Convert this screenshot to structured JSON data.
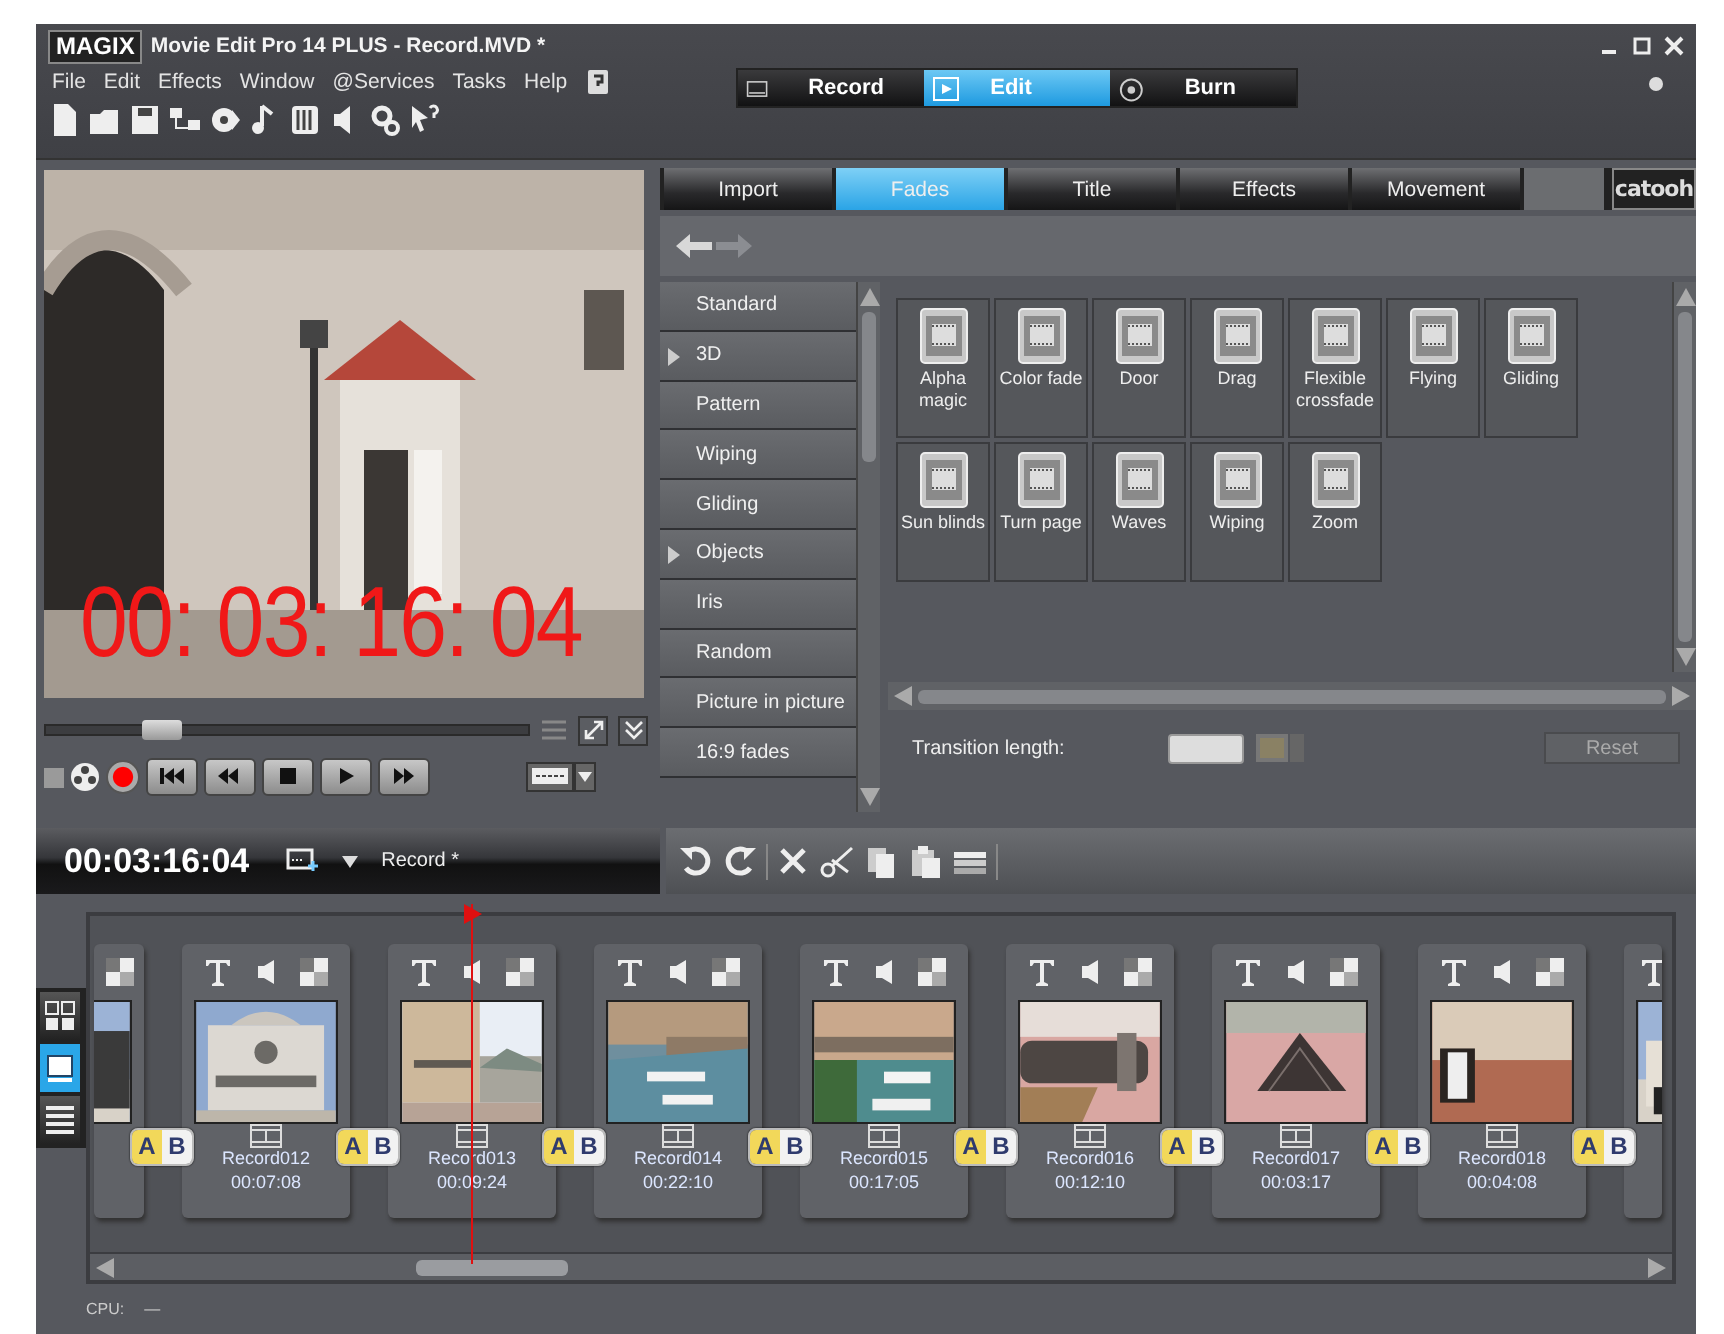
{
  "window": {
    "logo": "MAGIX",
    "title": "Movie Edit Pro 14 PLUS - Record.MVD *"
  },
  "menu": [
    "File",
    "Edit",
    "Effects",
    "Window",
    "@Services",
    "Tasks",
    "Help"
  ],
  "modes": [
    {
      "label": "Record",
      "selected": false
    },
    {
      "label": "Edit",
      "selected": true
    },
    {
      "label": "Burn",
      "selected": false
    }
  ],
  "preview": {
    "timecode_overlay": "00: 03: 16: 04",
    "level": 0.2
  },
  "panel": {
    "tabs": [
      {
        "label": "Import",
        "selected": false
      },
      {
        "label": "Fades",
        "selected": true
      },
      {
        "label": "Title",
        "selected": false
      },
      {
        "label": "Effects",
        "selected": false
      },
      {
        "label": "Movement",
        "selected": false
      }
    ],
    "logo": "catooh",
    "categories": [
      {
        "label": "Standard",
        "expandable": false
      },
      {
        "label": "3D",
        "expandable": true
      },
      {
        "label": "Pattern",
        "expandable": false
      },
      {
        "label": "Wiping",
        "expandable": false
      },
      {
        "label": "Gliding",
        "expandable": false
      },
      {
        "label": "Objects",
        "expandable": true
      },
      {
        "label": "Iris",
        "expandable": false
      },
      {
        "label": "Random",
        "expandable": false
      },
      {
        "label": "Picture in picture",
        "expandable": false
      },
      {
        "label": "16:9 fades",
        "expandable": false
      }
    ],
    "fades": [
      "Alpha magic",
      "Color fade",
      "Door",
      "Drag",
      "Flexible crossfade",
      "Flying",
      "Gliding",
      "Sun blinds",
      "Turn page",
      "Waves",
      "Wiping",
      "Zoom"
    ],
    "transition_length_label": "Transition length:",
    "reset": "Reset"
  },
  "arrangement": {
    "timecode": "00:03:16:04",
    "project": "Record *"
  },
  "view_modes": [
    {
      "selected": false
    },
    {
      "selected": true
    },
    {
      "selected": false
    }
  ],
  "clips": [
    {
      "kind": "partial_left"
    },
    {
      "kind": "clip",
      "name": "Record012",
      "duration": "00:07:08",
      "transition": [
        "A",
        "B"
      ]
    },
    {
      "kind": "clip",
      "name": "Record013",
      "duration": "00:09:24",
      "transition": [
        "A",
        "B"
      ]
    },
    {
      "kind": "clip",
      "name": "Record014",
      "duration": "00:22:10",
      "transition": [
        "A",
        "B"
      ]
    },
    {
      "kind": "clip",
      "name": "Record015",
      "duration": "00:17:05",
      "transition": [
        "A",
        "B"
      ]
    },
    {
      "kind": "clip",
      "name": "Record016",
      "duration": "00:12:10",
      "transition": [
        "A",
        "B"
      ]
    },
    {
      "kind": "clip",
      "name": "Record017",
      "duration": "00:03:17",
      "transition": [
        "A",
        "B"
      ]
    },
    {
      "kind": "clip",
      "name": "Record018",
      "duration": "00:04:08",
      "transition": [
        "A",
        "B"
      ]
    },
    {
      "kind": "partial_right",
      "transition": [
        "A",
        "B"
      ]
    }
  ],
  "status": {
    "cpu_label": "CPU:",
    "cpu_value": "—"
  }
}
